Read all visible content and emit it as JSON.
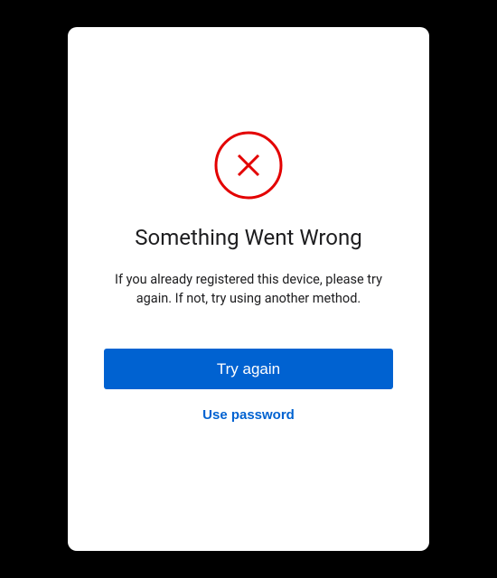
{
  "error": {
    "icon": "x-circle-icon",
    "icon_color": "#e30000",
    "title": "Something Went Wrong",
    "message": "If you already registered this device, please try again. If not, try using another method."
  },
  "actions": {
    "primary_label": "Try again",
    "secondary_label": "Use password"
  },
  "colors": {
    "primary": "#0062d1",
    "error": "#e30000"
  }
}
